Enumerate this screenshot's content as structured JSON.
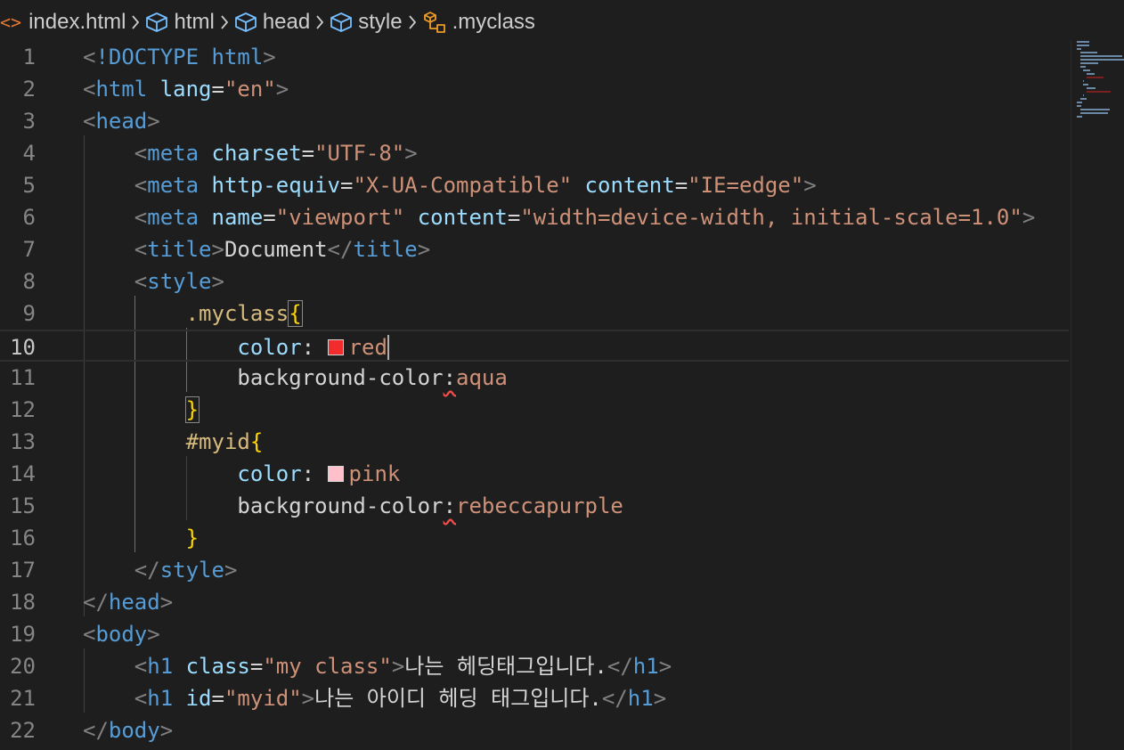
{
  "breadcrumb": {
    "items": [
      {
        "label": "index.html",
        "icon": "html-file-icon"
      },
      {
        "label": "html",
        "icon": "cube-icon"
      },
      {
        "label": "head",
        "icon": "cube-icon"
      },
      {
        "label": "style",
        "icon": "cube-icon"
      },
      {
        "label": ".myclass",
        "icon": "selector-icon"
      }
    ]
  },
  "editor": {
    "current_line": 10,
    "lines": [
      {
        "n": "1",
        "tokens": [
          [
            "punct",
            "<"
          ],
          [
            "tag",
            "!DOCTYPE"
          ],
          [
            "text",
            " "
          ],
          [
            "tag",
            "html"
          ],
          [
            "punct",
            ">"
          ]
        ]
      },
      {
        "n": "2",
        "tokens": [
          [
            "punct",
            "<"
          ],
          [
            "tag",
            "html"
          ],
          [
            "text",
            " "
          ],
          [
            "attr",
            "lang"
          ],
          [
            "text",
            "="
          ],
          [
            "str",
            "\"en\""
          ],
          [
            "punct",
            ">"
          ]
        ]
      },
      {
        "n": "3",
        "tokens": [
          [
            "punct",
            "<"
          ],
          [
            "tag",
            "head"
          ],
          [
            "punct",
            ">"
          ]
        ]
      },
      {
        "n": "4",
        "tokens": [
          [
            "text",
            "    "
          ],
          [
            "punct",
            "<"
          ],
          [
            "tag",
            "meta"
          ],
          [
            "text",
            " "
          ],
          [
            "attr",
            "charset"
          ],
          [
            "text",
            "="
          ],
          [
            "str",
            "\"UTF-8\""
          ],
          [
            "punct",
            ">"
          ]
        ]
      },
      {
        "n": "5",
        "tokens": [
          [
            "text",
            "    "
          ],
          [
            "punct",
            "<"
          ],
          [
            "tag",
            "meta"
          ],
          [
            "text",
            " "
          ],
          [
            "attr",
            "http-equiv"
          ],
          [
            "text",
            "="
          ],
          [
            "str",
            "\"X-UA-Compatible\""
          ],
          [
            "text",
            " "
          ],
          [
            "attr",
            "content"
          ],
          [
            "text",
            "="
          ],
          [
            "str",
            "\"IE=edge\""
          ],
          [
            "punct",
            ">"
          ]
        ]
      },
      {
        "n": "6",
        "tokens": [
          [
            "text",
            "    "
          ],
          [
            "punct",
            "<"
          ],
          [
            "tag",
            "meta"
          ],
          [
            "text",
            " "
          ],
          [
            "attr",
            "name"
          ],
          [
            "text",
            "="
          ],
          [
            "str",
            "\"viewport\""
          ],
          [
            "text",
            " "
          ],
          [
            "attr",
            "content"
          ],
          [
            "text",
            "="
          ],
          [
            "str",
            "\"width=device-width, initial-scale=1.0\""
          ],
          [
            "punct",
            ">"
          ]
        ]
      },
      {
        "n": "7",
        "tokens": [
          [
            "text",
            "    "
          ],
          [
            "punct",
            "<"
          ],
          [
            "tag",
            "title"
          ],
          [
            "punct",
            ">"
          ],
          [
            "text",
            "Document"
          ],
          [
            "punct",
            "</"
          ],
          [
            "tag",
            "title"
          ],
          [
            "punct",
            ">"
          ]
        ]
      },
      {
        "n": "8",
        "tokens": [
          [
            "text",
            "    "
          ],
          [
            "punct",
            "<"
          ],
          [
            "tag",
            "style"
          ],
          [
            "punct",
            ">"
          ]
        ]
      },
      {
        "n": "9",
        "tokens": [
          [
            "text",
            "        "
          ],
          [
            "sel",
            ".myclass"
          ],
          [
            "bracematch",
            "{"
          ]
        ]
      },
      {
        "n": "10",
        "tokens": [
          [
            "text",
            "            "
          ],
          [
            "prop",
            "color"
          ],
          [
            "plain",
            ": "
          ],
          [
            "swatch",
            "#f22c2c"
          ],
          [
            "val",
            "red"
          ],
          [
            "cursor",
            ""
          ]
        ]
      },
      {
        "n": "11",
        "tokens": [
          [
            "text",
            "            "
          ],
          [
            "plain",
            "background-color"
          ],
          [
            "err",
            ":"
          ],
          [
            "val",
            "aqua"
          ]
        ]
      },
      {
        "n": "12",
        "tokens": [
          [
            "text",
            "        "
          ],
          [
            "bracematch",
            "}"
          ]
        ]
      },
      {
        "n": "13",
        "tokens": [
          [
            "text",
            "        "
          ],
          [
            "sel",
            "#myid"
          ],
          [
            "brace",
            "{"
          ]
        ]
      },
      {
        "n": "14",
        "tokens": [
          [
            "text",
            "            "
          ],
          [
            "prop",
            "color"
          ],
          [
            "plain",
            ": "
          ],
          [
            "swatch",
            "#ffc0cb"
          ],
          [
            "val",
            "pink"
          ]
        ]
      },
      {
        "n": "15",
        "tokens": [
          [
            "text",
            "            "
          ],
          [
            "plain",
            "background-color"
          ],
          [
            "err",
            ":"
          ],
          [
            "val",
            "rebeccapurple"
          ]
        ]
      },
      {
        "n": "16",
        "tokens": [
          [
            "text",
            "        "
          ],
          [
            "brace",
            "}"
          ]
        ]
      },
      {
        "n": "17",
        "tokens": [
          [
            "text",
            "    "
          ],
          [
            "punct",
            "</"
          ],
          [
            "tag",
            "style"
          ],
          [
            "punct",
            ">"
          ]
        ]
      },
      {
        "n": "18",
        "tokens": [
          [
            "punct",
            "</"
          ],
          [
            "tag",
            "head"
          ],
          [
            "punct",
            ">"
          ]
        ]
      },
      {
        "n": "19",
        "tokens": [
          [
            "punct",
            "<"
          ],
          [
            "tag",
            "body"
          ],
          [
            "punct",
            ">"
          ]
        ]
      },
      {
        "n": "20",
        "tokens": [
          [
            "text",
            "    "
          ],
          [
            "punct",
            "<"
          ],
          [
            "tag",
            "h1"
          ],
          [
            "text",
            " "
          ],
          [
            "attr",
            "class"
          ],
          [
            "text",
            "="
          ],
          [
            "str",
            "\"my class\""
          ],
          [
            "punct",
            ">"
          ],
          [
            "text",
            "나는 헤딩태그입니다."
          ],
          [
            "punct",
            "</"
          ],
          [
            "tag",
            "h1"
          ],
          [
            "punct",
            ">"
          ]
        ]
      },
      {
        "n": "21",
        "tokens": [
          [
            "text",
            "    "
          ],
          [
            "punct",
            "<"
          ],
          [
            "tag",
            "h1"
          ],
          [
            "text",
            " "
          ],
          [
            "attr",
            "id"
          ],
          [
            "text",
            "="
          ],
          [
            "str",
            "\"myid\""
          ],
          [
            "punct",
            ">"
          ],
          [
            "text",
            "나는 아이디 헤딩 태그입니다."
          ],
          [
            "punct",
            "</"
          ],
          [
            "tag",
            "h1"
          ],
          [
            "punct",
            ">"
          ]
        ]
      },
      {
        "n": "22",
        "tokens": [
          [
            "punct",
            "</"
          ],
          [
            "tag",
            "body"
          ],
          [
            "punct",
            ">"
          ]
        ]
      }
    ]
  },
  "colors": {
    "background": "#1e1e1e",
    "tag": "#569cd6",
    "attribute": "#9cdcfe",
    "string": "#ce9178",
    "selector": "#d7ba7d",
    "brace": "#ffd700",
    "line_number": "#858585"
  }
}
